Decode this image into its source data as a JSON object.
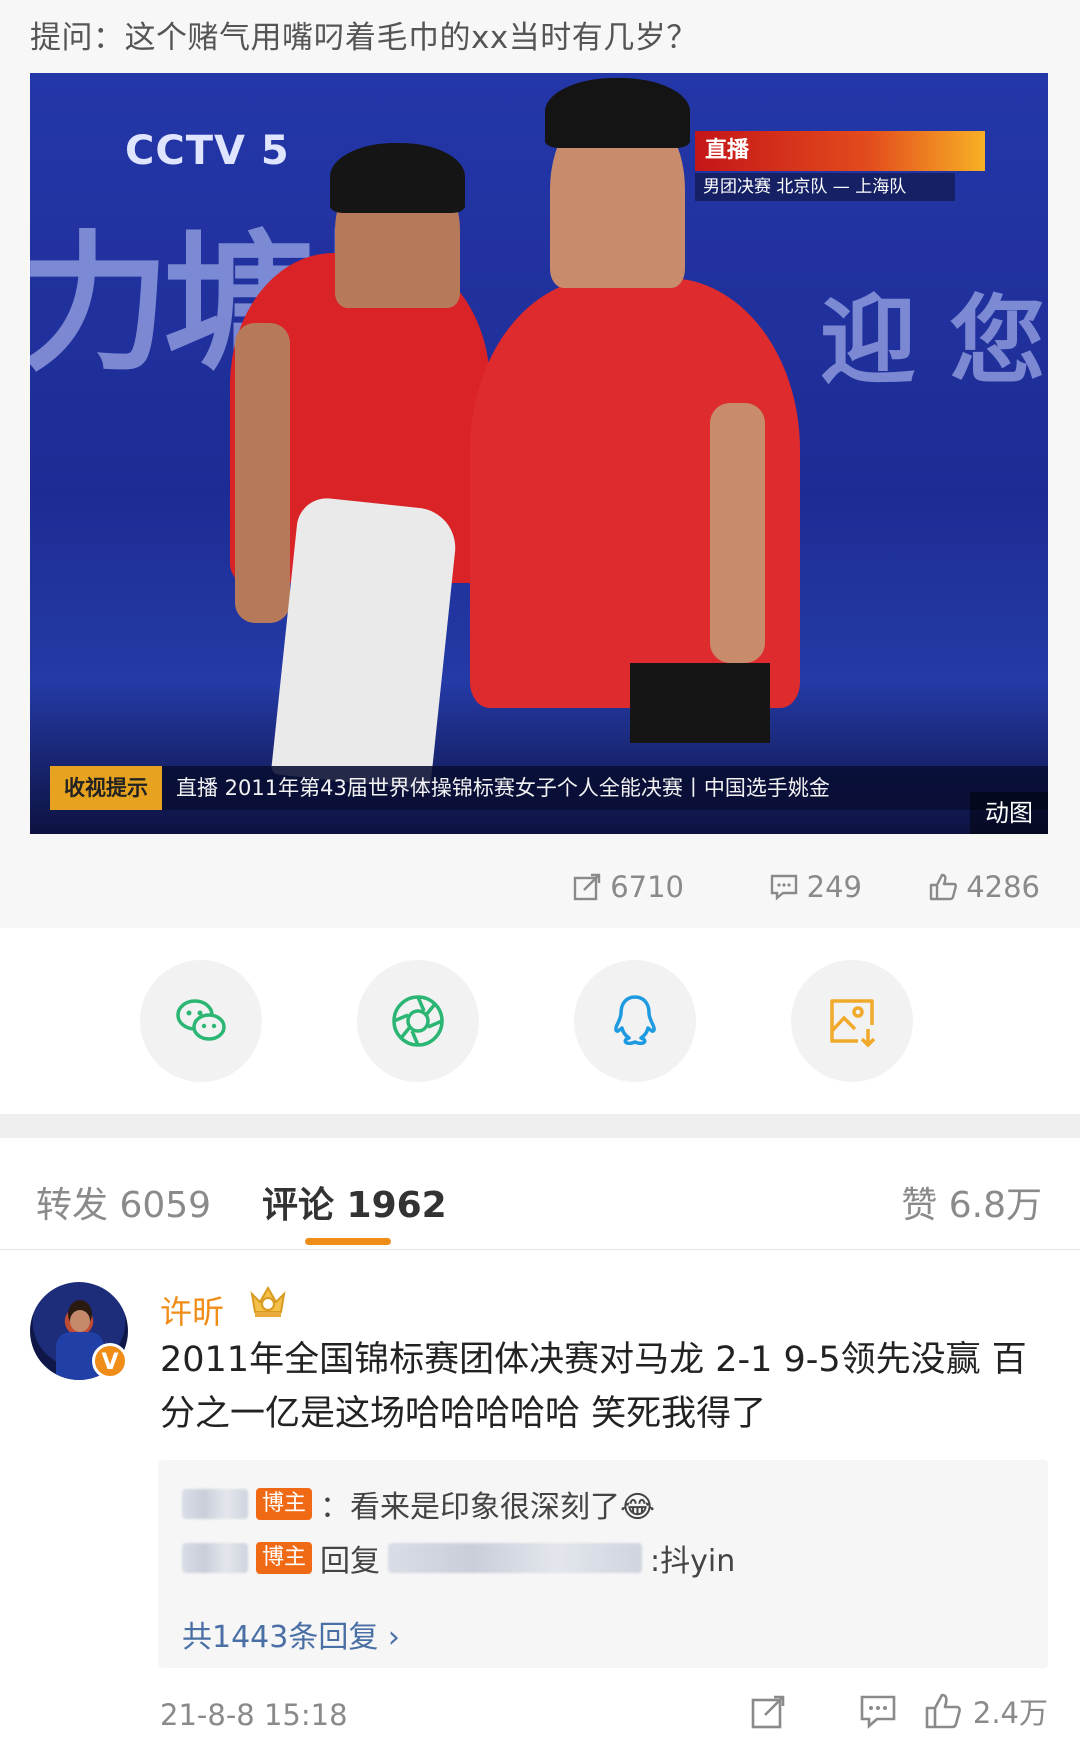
{
  "question": "提问：这个赌气用嘴叼着毛巾的xx当时有几岁？",
  "media": {
    "channel_logo": "CCTV 5",
    "live_label": "直播",
    "match_text": "男团决赛 北京队 — 上海队",
    "ticker_tag": "收视提示",
    "ticker_text": "直播 2011年第43届世界体操锦标赛女子个人全能决赛丨中国选手姚金",
    "bg_text_left": "力塘桥",
    "bg_text_right": "迎 您",
    "gif_badge": "动图"
  },
  "stats": {
    "repost": "6710",
    "comments": "249",
    "likes": "4286"
  },
  "share": {
    "icons": [
      "wechat-icon",
      "moments-icon",
      "qq-icon",
      "save-image-icon"
    ]
  },
  "tabs": {
    "repost": "转发 6059",
    "comment": "评论 1962",
    "like": "赞 6.8万"
  },
  "comment": {
    "username": "许昕",
    "verified_mark": "V",
    "text": "2011年全国锦标赛团体决赛对马龙 2-1 9-5领先没赢 百分之一亿是这场哈哈哈哈哈 笑死我得了",
    "replies": [
      {
        "badge": "博主",
        "text": "：看来是印象很深刻了😂"
      },
      {
        "badge": "博主",
        "prefix": "回复",
        "suffix": ":抖yin"
      }
    ],
    "more_replies": "共1443条回复 ›",
    "time": "21-8-8 15:18",
    "like_count": "2.4万"
  },
  "colors": {
    "accent": "#f08d18",
    "link": "#4a6fa5",
    "muted": "#8a8a8a"
  }
}
